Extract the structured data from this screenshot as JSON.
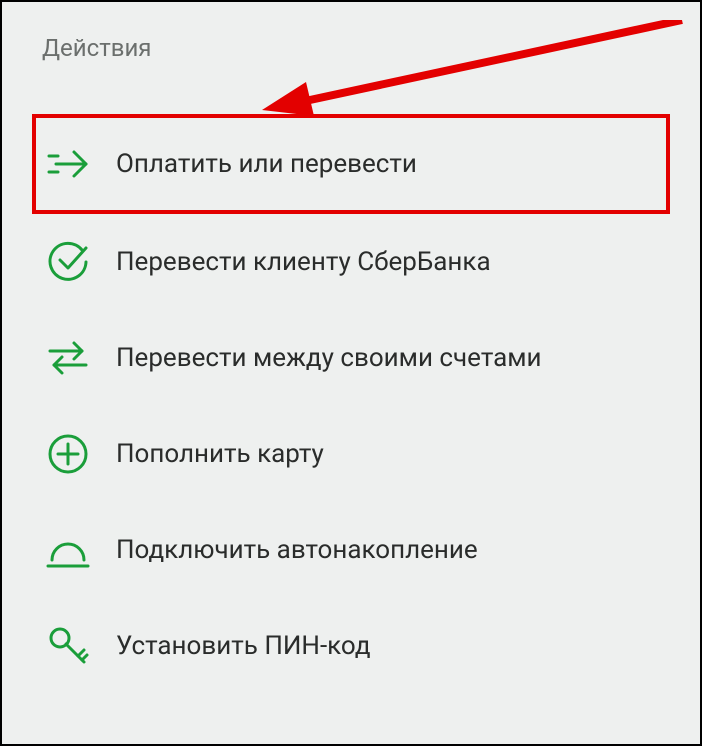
{
  "section": {
    "title": "Действия"
  },
  "menu": {
    "items": [
      {
        "label": "Оплатить или перевести",
        "icon": "arrow-right-icon",
        "highlighted": true
      },
      {
        "label": "Перевести клиенту СберБанка",
        "icon": "check-circle-icon",
        "highlighted": false
      },
      {
        "label": "Перевести между своими счетами",
        "icon": "swap-icon",
        "highlighted": false
      },
      {
        "label": "Пополнить карту",
        "icon": "plus-circle-icon",
        "highlighted": false
      },
      {
        "label": "Подключить автонакопление",
        "icon": "auto-save-icon",
        "highlighted": false
      },
      {
        "label": "Установить ПИН-код",
        "icon": "key-icon",
        "highlighted": false
      }
    ]
  },
  "colors": {
    "accent_green": "#1a9e3a",
    "highlight_red": "#e30000"
  }
}
